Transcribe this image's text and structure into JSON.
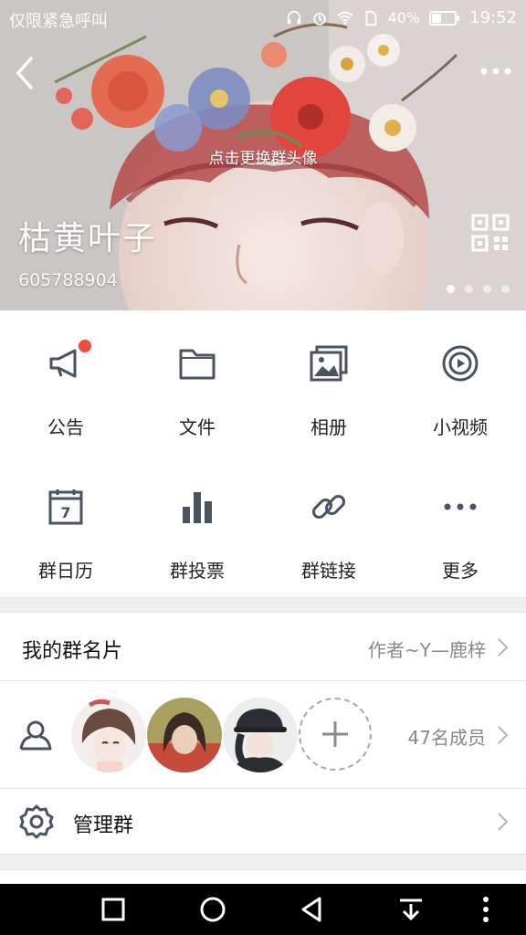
{
  "status_bar": {
    "carrier_text": "仅限紧急呼叫",
    "battery": "40%",
    "time": "19:52"
  },
  "header": {
    "change_avatar_text": "点击更换群头像",
    "group_name": "枯黄叶子",
    "group_id": "605788904",
    "page_dots_total": 4,
    "page_dot_active": 1
  },
  "features": [
    {
      "label": "公告",
      "icon": "megaphone-icon",
      "has_badge": true
    },
    {
      "label": "文件",
      "icon": "folder-icon"
    },
    {
      "label": "相册",
      "icon": "album-icon"
    },
    {
      "label": "小视频",
      "icon": "video-icon"
    },
    {
      "label": "群日历",
      "icon": "calendar-icon",
      "calendar_day": "7"
    },
    {
      "label": "群投票",
      "icon": "bar-chart-icon"
    },
    {
      "label": "群链接",
      "icon": "link-icon"
    },
    {
      "label": "更多",
      "icon": "more-dots-icon"
    }
  ],
  "card_row": {
    "title": "我的群名片",
    "value": "作者~Y—鹿梓"
  },
  "members_row": {
    "count_text": "47名成员"
  },
  "manage_row": {
    "title": "管理群"
  },
  "colors": {
    "icon_gray": "#4a5360",
    "badge_red": "#f24b3b"
  }
}
